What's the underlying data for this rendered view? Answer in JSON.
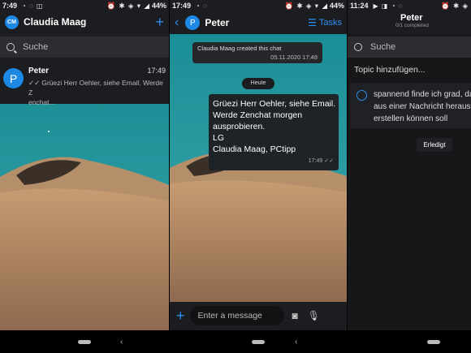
{
  "colors": {
    "accent": "#2e8ff0",
    "avatar": "#1e88e5",
    "bg": "#1b1d20"
  },
  "panel1": {
    "status": {
      "time": "7:49",
      "battery": "44%"
    },
    "header": {
      "avatar_initials": "CM",
      "title": "Claudia Maag",
      "add_icon": "plus-icon"
    },
    "search": {
      "placeholder": "Suche"
    },
    "chat": {
      "avatar_letter": "P",
      "name": "Peter",
      "time": "17:49",
      "preview_line1": "Grüezi Herr Oehler, siehe Email. Werde Z",
      "preview_line2": "enchat..."
    }
  },
  "panel2": {
    "status": {
      "time": "17:49",
      "battery": "44%"
    },
    "header": {
      "avatar_letter": "P",
      "title": "Peter",
      "tasks_label": "Tasks"
    },
    "system_message": {
      "text": "Claudia Maag created this chat",
      "time": "05.11.2020 17:48"
    },
    "date_pill": "Heute",
    "message": {
      "lines": [
        "Grüezi Herr Oehler, siehe Email.",
        "Werde Zenchat morgen",
        "ausprobieren.",
        "LG",
        "Claudia Maag, PCtipp"
      ],
      "time": "17:49"
    },
    "composer": {
      "placeholder": "Enter a message"
    }
  },
  "panel3": {
    "status": {
      "time": "11:24"
    },
    "header": {
      "title": "Peter",
      "subtitle": "0/1 completed"
    },
    "search": {
      "placeholder": "Suche"
    },
    "add_topic": "Topic hinzufügen...",
    "task": {
      "lines": [
        "spannend finde ich grad, da",
        "aus einer Nachricht heraus",
        "erstellen können soll"
      ]
    },
    "done_button": "Erledigt"
  }
}
